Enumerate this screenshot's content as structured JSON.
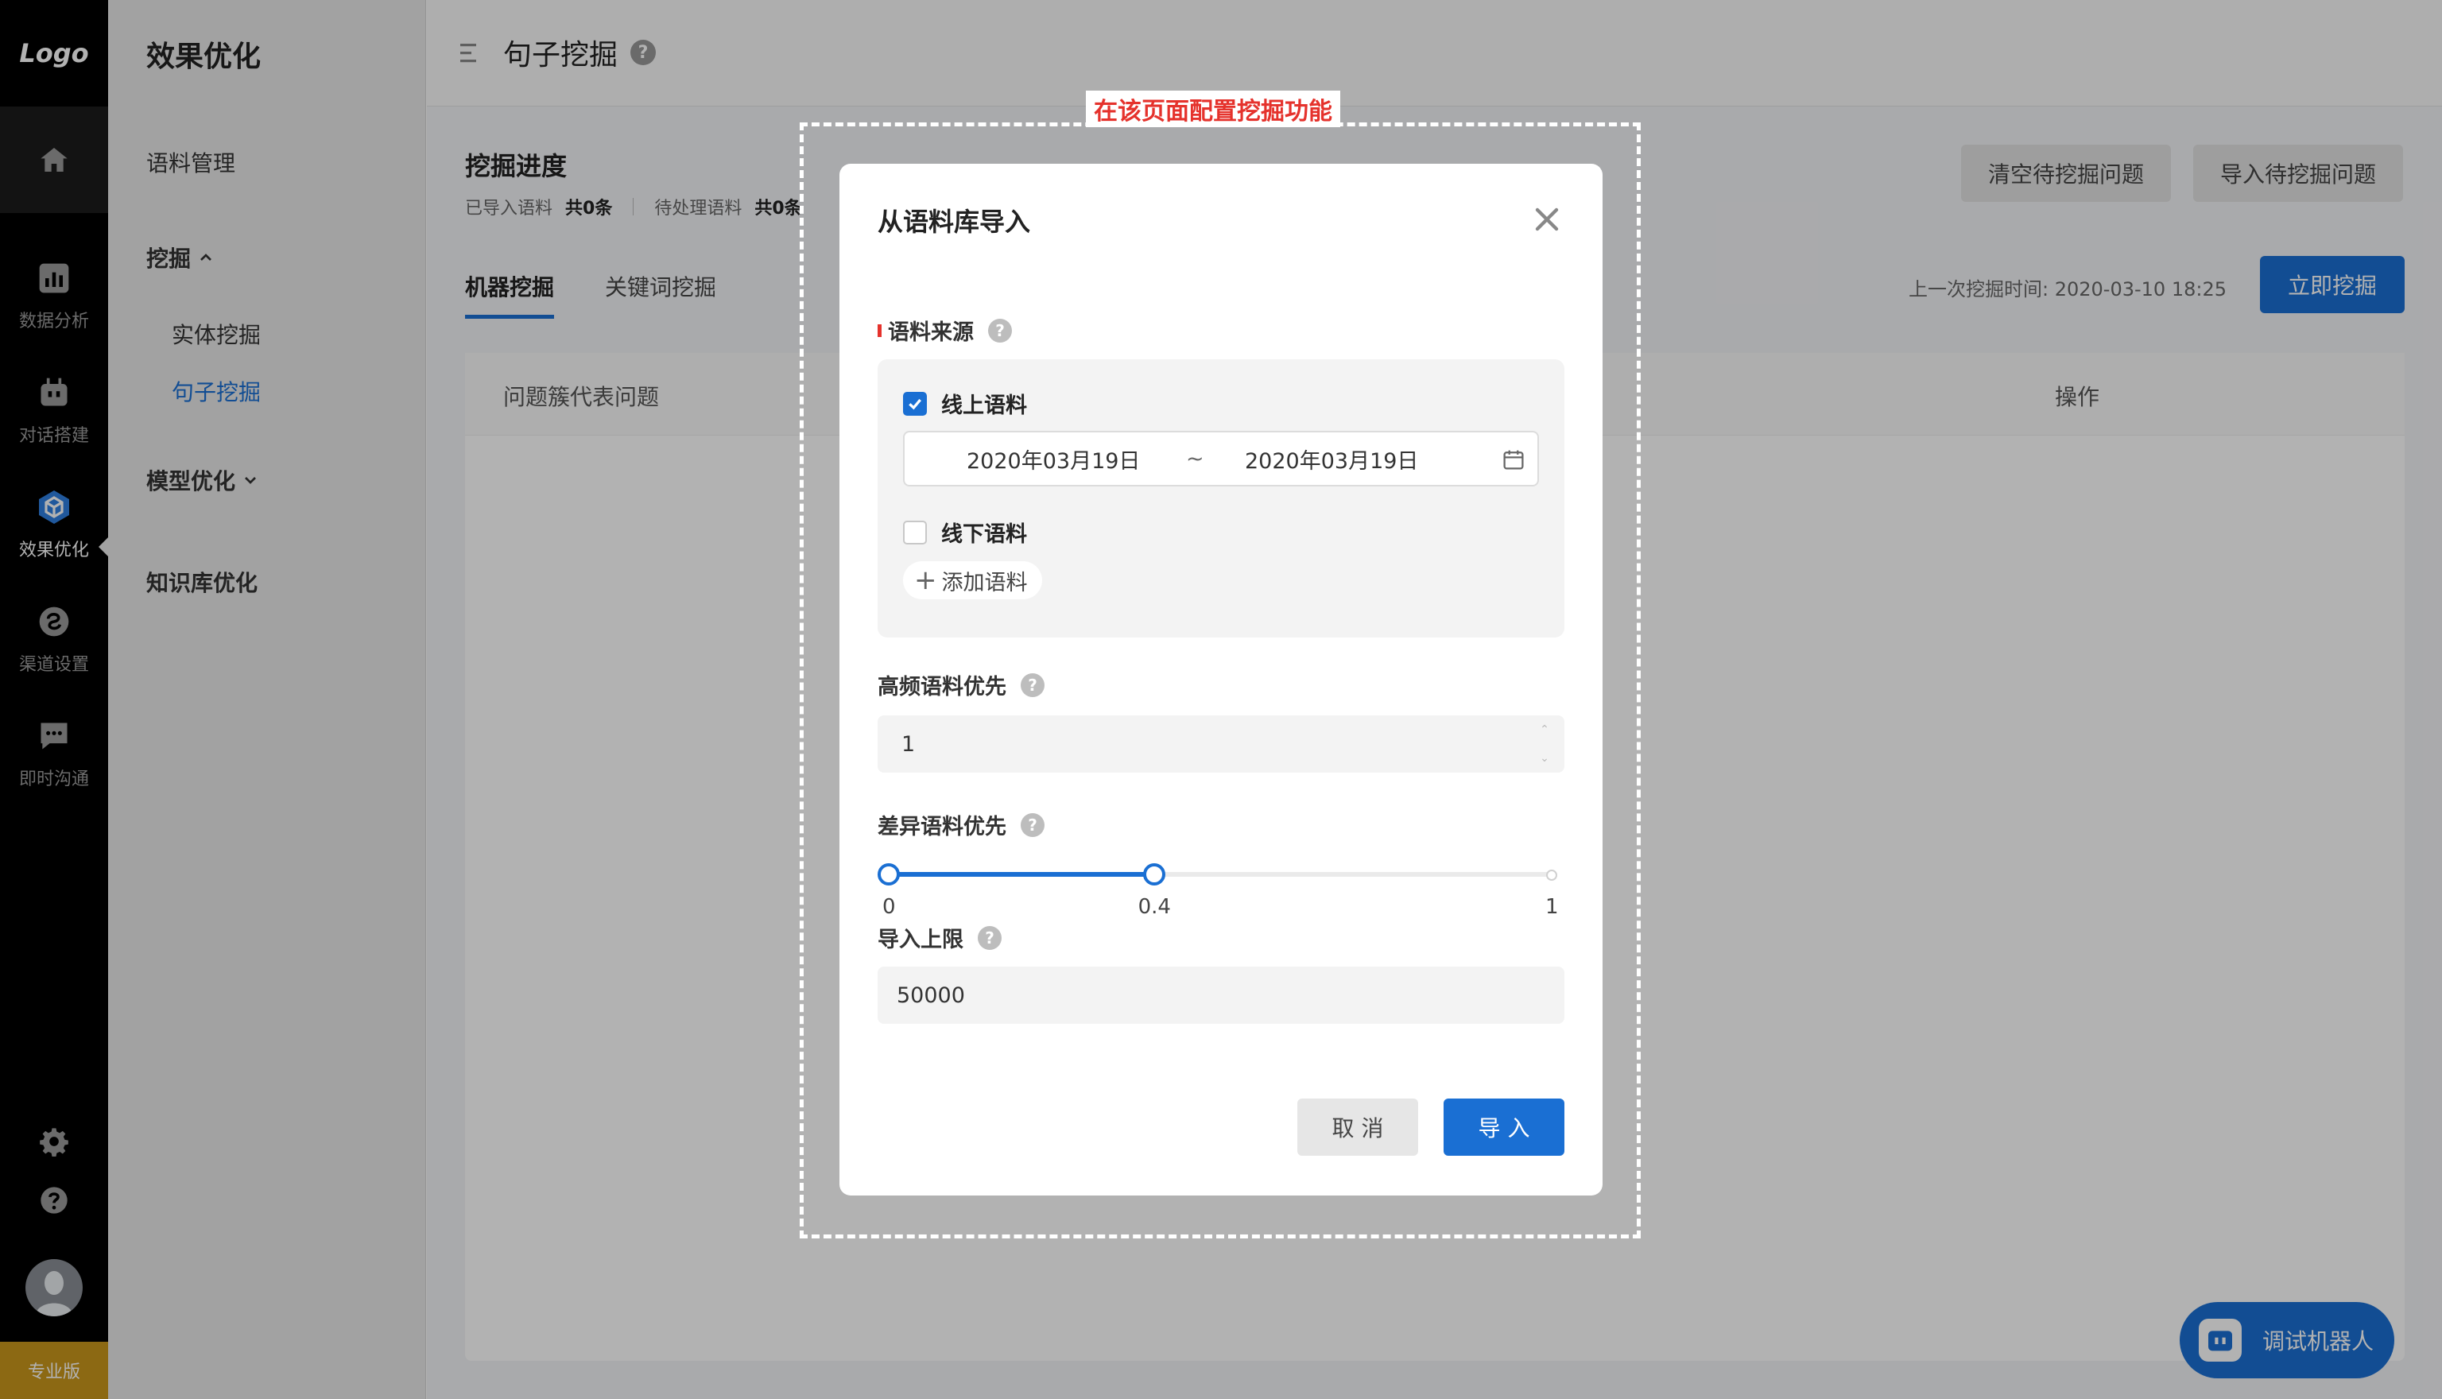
{
  "rail": {
    "logo": "Logo",
    "items": [
      {
        "label": "数据分析",
        "icon": "bar-chart-icon"
      },
      {
        "label": "对话搭建",
        "icon": "robot-icon"
      },
      {
        "label": "效果优化",
        "icon": "cube-icon",
        "active": true
      },
      {
        "label": "渠道设置",
        "icon": "channel-icon"
      },
      {
        "label": "即时沟通",
        "icon": "chat-icon"
      }
    ],
    "edition": "专业版"
  },
  "subnav": {
    "title": "效果优化",
    "items": {
      "corpus": "语料管理",
      "mining": "挖掘",
      "entity_mining": "实体挖掘",
      "sentence_mining": "句子挖掘",
      "model_opt": "模型优化",
      "kb_opt": "知识库优化"
    }
  },
  "page": {
    "title": "句子挖掘",
    "section_title": "挖掘进度",
    "stats": {
      "imported_label": "已导入语料",
      "imported_value": "共0条",
      "pending_label": "待处理语料",
      "pending_value": "共0条"
    },
    "buttons": {
      "clear": "清空待挖掘问题",
      "import": "导入待挖掘问题",
      "mine_now": "立即挖掘"
    },
    "tabs": [
      "机器挖掘",
      "关键词挖掘"
    ],
    "last_time": "上一次挖掘时间:  2020-03-10 18:25",
    "table": {
      "col_question": "问题簇代表问题",
      "col_action": "操作"
    },
    "debug_bot": "调试机器人"
  },
  "annotation": {
    "label": "在该页面配置挖掘功能",
    "color": "#e5322c"
  },
  "dialog": {
    "title": "从语料库导入",
    "source_label": "语料来源",
    "online": {
      "label": "线上语料",
      "checked": true
    },
    "date_start": "2020年03月19日",
    "date_sep": "~",
    "date_end": "2020年03月19日",
    "offline": {
      "label": "线下语料",
      "checked": false
    },
    "add_corpus": "添加语料",
    "hf_label": "高频语料优先",
    "hf_value": "1",
    "diff_label": "差异语料优先",
    "slider": {
      "min": 0,
      "max": 1,
      "value": 0.4,
      "min_label": "0",
      "value_label": "0.4",
      "max_label": "1"
    },
    "limit_label": "导入上限",
    "limit_value": "50000",
    "cancel": "取 消",
    "ok": "导 入"
  },
  "colors": {
    "primary": "#1a6fd3",
    "rail": "#000000",
    "edition": "#c9971c"
  }
}
